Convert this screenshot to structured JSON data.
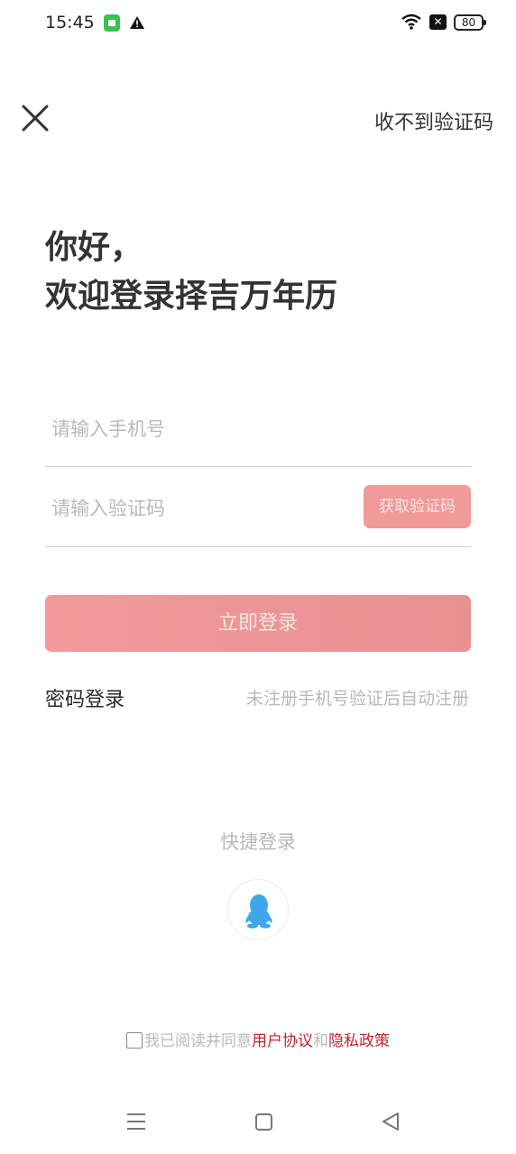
{
  "status_bar": {
    "time": "15:45",
    "battery": "80",
    "icons": [
      "app-notification-icon",
      "warning-icon",
      "wifi-icon",
      "notification-badge-icon",
      "battery-icon"
    ]
  },
  "header": {
    "close_icon": "close-icon",
    "no_code_link": "收不到验证码"
  },
  "greeting": {
    "line1": "你好，",
    "line2": "欢迎登录择吉万年历"
  },
  "form": {
    "phone_placeholder": "请输入手机号",
    "code_placeholder": "请输入验证码",
    "get_code_button": "获取验证码",
    "login_button": "立即登录"
  },
  "options": {
    "password_login": "密码登录",
    "auto_register_hint": "未注册手机号验证后自动注册"
  },
  "quick_login": {
    "title": "快捷登录",
    "qq_icon": "qq-icon"
  },
  "agreement": {
    "prefix": "我已阅读并同意",
    "user_agreement": "用户协议",
    "and": "和",
    "privacy_policy": "隐私政策"
  },
  "nav_bar": {
    "icons": [
      "menu-icon",
      "home-icon",
      "back-icon"
    ]
  },
  "colors": {
    "accent": "#f09a9a",
    "link": "#c0262d",
    "hint": "#b9b9b9",
    "qq": "#3fa6ee"
  }
}
